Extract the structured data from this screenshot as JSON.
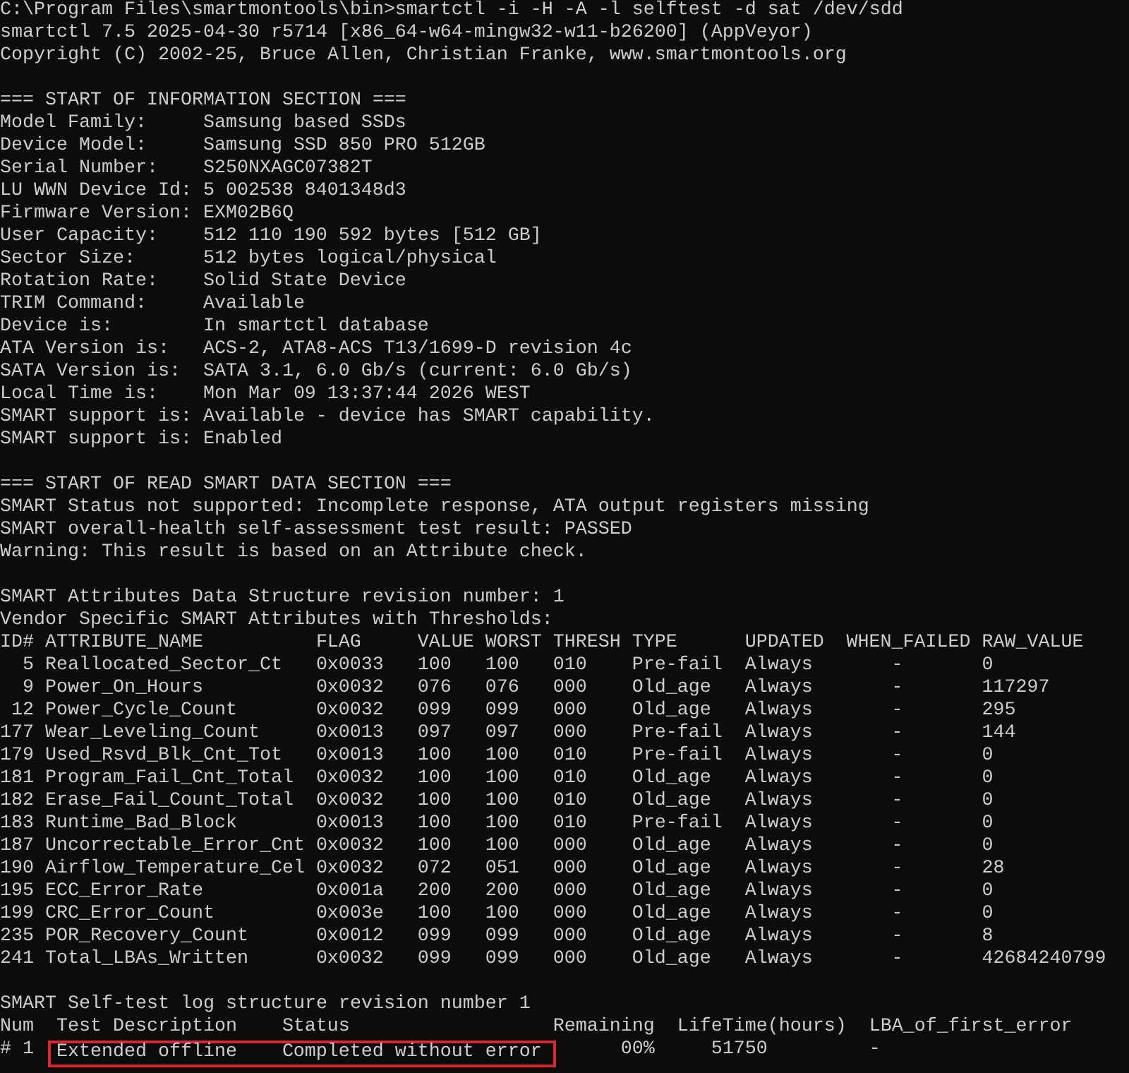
{
  "command_prompt": "C:\\Program Files\\smartmontools\\bin>smartctl -i -H -A -l selftest -d sat /dev/sdd",
  "banner": [
    "smartctl 7.5 2025-04-30 r5714 [x86_64-w64-mingw32-w11-b26200] (AppVeyor)",
    "Copyright (C) 2002-25, Bruce Allen, Christian Franke, www.smartmontools.org"
  ],
  "information_section": {
    "heading": "=== START OF INFORMATION SECTION ===",
    "fields": [
      {
        "label": "Model Family:",
        "value": "Samsung based SSDs"
      },
      {
        "label": "Device Model:",
        "value": "Samsung SSD 850 PRO 512GB"
      },
      {
        "label": "Serial Number:",
        "value": "S250NXAGC07382T"
      },
      {
        "label": "LU WWN Device Id:",
        "value": "5 002538 8401348d3"
      },
      {
        "label": "Firmware Version:",
        "value": "EXM02B6Q"
      },
      {
        "label": "User Capacity:",
        "value": "512 110 190 592 bytes [512 GB]"
      },
      {
        "label": "Sector Size:",
        "value": "512 bytes logical/physical"
      },
      {
        "label": "Rotation Rate:",
        "value": "Solid State Device"
      },
      {
        "label": "TRIM Command:",
        "value": "Available"
      },
      {
        "label": "Device is:",
        "value": "In smartctl database"
      },
      {
        "label": "ATA Version is:",
        "value": "ACS-2, ATA8-ACS T13/1699-D revision 4c"
      },
      {
        "label": "SATA Version is:",
        "value": "SATA 3.1, 6.0 Gb/s (current: 6.0 Gb/s)"
      },
      {
        "label": "Local Time is:",
        "value": "Mon Mar 09 13:37:44 2026 WEST"
      },
      {
        "label": "SMART support is:",
        "value": "Available - device has SMART capability."
      },
      {
        "label": "SMART support is:",
        "value": "Enabled"
      }
    ]
  },
  "read_section": {
    "heading": "=== START OF READ SMART DATA SECTION ===",
    "lines": [
      "SMART Status not supported: Incomplete response, ATA output registers missing",
      "SMART overall-health self-assessment test result: PASSED",
      "Warning: This result is based on an Attribute check."
    ]
  },
  "attributes": {
    "lines": [
      "SMART Attributes Data Structure revision number: 1",
      "Vendor Specific SMART Attributes with Thresholds:"
    ],
    "columns": [
      "ID#",
      "ATTRIBUTE_NAME",
      "FLAG",
      "VALUE",
      "WORST",
      "THRESH",
      "TYPE",
      "UPDATED",
      "WHEN_FAILED",
      "RAW_VALUE"
    ],
    "rows": [
      [
        "5",
        "Reallocated_Sector_Ct",
        "0x0033",
        "100",
        "100",
        "010",
        "Pre-fail",
        "Always",
        "-",
        "0"
      ],
      [
        "9",
        "Power_On_Hours",
        "0x0032",
        "076",
        "076",
        "000",
        "Old_age",
        "Always",
        "-",
        "117297"
      ],
      [
        "12",
        "Power_Cycle_Count",
        "0x0032",
        "099",
        "099",
        "000",
        "Old_age",
        "Always",
        "-",
        "295"
      ],
      [
        "177",
        "Wear_Leveling_Count",
        "0x0013",
        "097",
        "097",
        "000",
        "Pre-fail",
        "Always",
        "-",
        "144"
      ],
      [
        "179",
        "Used_Rsvd_Blk_Cnt_Tot",
        "0x0013",
        "100",
        "100",
        "010",
        "Pre-fail",
        "Always",
        "-",
        "0"
      ],
      [
        "181",
        "Program_Fail_Cnt_Total",
        "0x0032",
        "100",
        "100",
        "010",
        "Old_age",
        "Always",
        "-",
        "0"
      ],
      [
        "182",
        "Erase_Fail_Count_Total",
        "0x0032",
        "100",
        "100",
        "010",
        "Old_age",
        "Always",
        "-",
        "0"
      ],
      [
        "183",
        "Runtime_Bad_Block",
        "0x0013",
        "100",
        "100",
        "010",
        "Pre-fail",
        "Always",
        "-",
        "0"
      ],
      [
        "187",
        "Uncorrectable_Error_Cnt",
        "0x0032",
        "100",
        "100",
        "000",
        "Old_age",
        "Always",
        "-",
        "0"
      ],
      [
        "190",
        "Airflow_Temperature_Cel",
        "0x0032",
        "072",
        "051",
        "000",
        "Old_age",
        "Always",
        "-",
        "28"
      ],
      [
        "195",
        "ECC_Error_Rate",
        "0x001a",
        "200",
        "200",
        "000",
        "Old_age",
        "Always",
        "-",
        "0"
      ],
      [
        "199",
        "CRC_Error_Count",
        "0x003e",
        "100",
        "100",
        "000",
        "Old_age",
        "Always",
        "-",
        "0"
      ],
      [
        "235",
        "POR_Recovery_Count",
        "0x0012",
        "099",
        "099",
        "000",
        "Old_age",
        "Always",
        "-",
        "8"
      ],
      [
        "241",
        "Total_LBAs_Written",
        "0x0032",
        "099",
        "099",
        "000",
        "Old_age",
        "Always",
        "-",
        "42684240799"
      ]
    ]
  },
  "self_test_log": {
    "title": "SMART Self-test log structure revision number 1",
    "columns": [
      "Num",
      "Test Description",
      "Status",
      "Remaining",
      "LifeTime(hours)",
      "LBA_of_first_error"
    ],
    "rows": [
      {
        "cells": [
          "# 1",
          "Extended offline",
          "Completed without error",
          "00%",
          "51750",
          "-"
        ],
        "highlighted": true
      }
    ]
  }
}
